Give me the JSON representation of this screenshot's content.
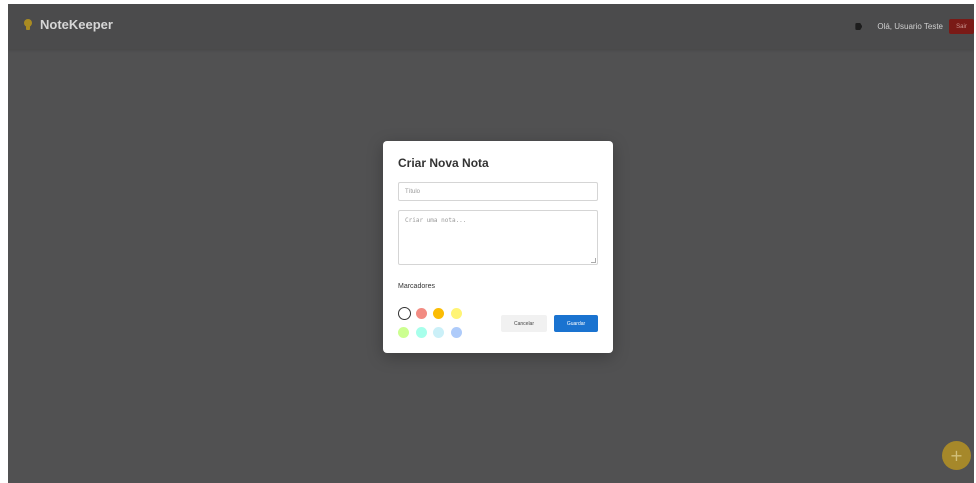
{
  "app": {
    "title": "NoteKeeper",
    "greeting": "Olá, Usuario Teste",
    "logout_label": "Sair"
  },
  "modal": {
    "title": "Criar Nova Nota",
    "title_placeholder": "Título",
    "note_placeholder": "Criar uma nota...",
    "markers_label": "Marcadores",
    "colors": [
      "#ffffff",
      "#f28b82",
      "#fbbc04",
      "#fff475",
      "#ccff90",
      "#a7ffeb",
      "#cbf0f8",
      "#aecbfa"
    ],
    "cancel_label": "Cancelar",
    "save_label": "Guardar"
  },
  "fab": {
    "icon": "plus-icon",
    "label": "+"
  },
  "icons": {
    "brand": "lightbulb-icon",
    "labels": "tag-icon"
  }
}
